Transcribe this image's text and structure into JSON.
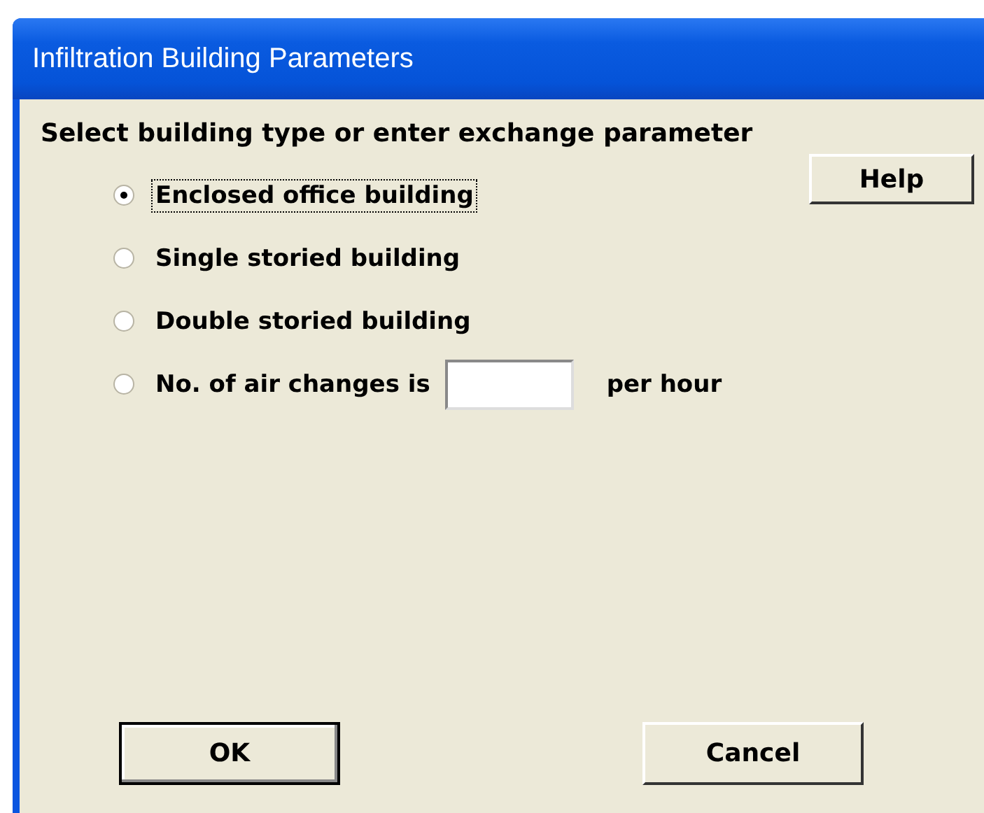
{
  "window": {
    "title": "Infiltration Building Parameters"
  },
  "prompt": "Select building type or enter exchange parameter",
  "options": [
    {
      "kind": "radio",
      "label": "Enclosed office building",
      "selected": true,
      "focused": true
    },
    {
      "kind": "radio",
      "label": "Single storied building",
      "selected": false,
      "focused": false
    },
    {
      "kind": "radio",
      "label": "Double storied building",
      "selected": false,
      "focused": false
    },
    {
      "kind": "field",
      "label": "No. of air changes is",
      "suffix": "per hour",
      "selected": false,
      "focused": false
    }
  ],
  "help_button": "Help",
  "buttons": [
    {
      "label": "OK",
      "default": true
    },
    {
      "label": "Cancel",
      "default": false
    }
  ]
}
